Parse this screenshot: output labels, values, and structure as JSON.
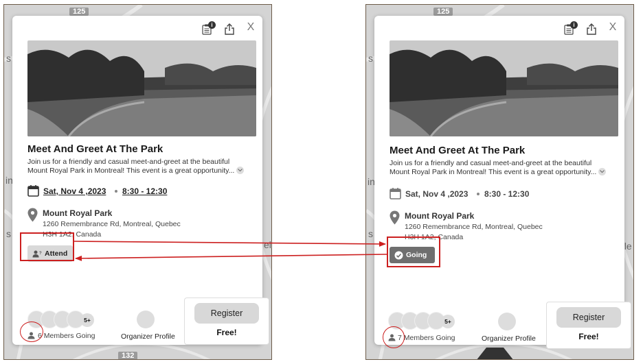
{
  "left": {
    "road_top": "125",
    "road_bottom": "132",
    "title": "Meet And Greet At The Park",
    "description_line1": "Join us for a friendly and casual meet-and-greet at the beautiful",
    "description_line2": "Mount Royal Park in  Montreal! This event is a great opportunity...",
    "date": "Sat, Nov 4 ,2023",
    "time": "8:30 - 12:30",
    "location_name": "Mount Royal Park",
    "address_line1": "1260 Remembrance Rd, Montreal, Quebec",
    "address_line2": "H3H 1A2, Canada",
    "attend_label": "Attend",
    "more_count": "5+",
    "members_count": "6",
    "members_label": "Members Going",
    "organizer_label": "Organizer Profile",
    "register_label": "Register",
    "price_label": "Free!",
    "badge": "i",
    "close": "X"
  },
  "right": {
    "road_top": "125",
    "title": "Meet And Greet At The Park",
    "description_line1": "Join us for a friendly and casual meet-and-greet at the beautiful",
    "description_line2": "Mount Royal Park in  Montreal! This event is a great opportunity...",
    "date": "Sat, Nov 4 ,2023",
    "time": "8:30 - 12:30",
    "location_name": "Mount Royal Park",
    "address_line1": "1260 Remembrance Rd, Montreal, Quebec",
    "address_line2": "H3H 1A2, Canada",
    "going_label": "Going",
    "more_count": "5+",
    "members_count": "7",
    "members_label": "Members Going",
    "organizer_label": "Organizer Profile",
    "register_label": "Register",
    "price_label": "Free!",
    "badge": "i",
    "close": "X"
  },
  "side_letters": {
    "left_s1": "s",
    "left_in": "in",
    "left_s2": "s",
    "left_e": "el",
    "right_s1": "s",
    "right_in": "in",
    "right_s2": "s",
    "right_e": "ele"
  },
  "colors": {
    "highlight": "#cc1f1f",
    "attend_bg": "#d9d9d9",
    "going_bg": "#6f6f6f",
    "frame": "#6b5a48"
  },
  "icons": {
    "clipboard": "clipboard-icon",
    "share": "share-icon",
    "close": "close-icon",
    "calendar": "calendar-icon",
    "location": "location-pin-icon",
    "person_question": "person-question-icon",
    "check": "check-circle-icon",
    "person": "person-icon"
  }
}
